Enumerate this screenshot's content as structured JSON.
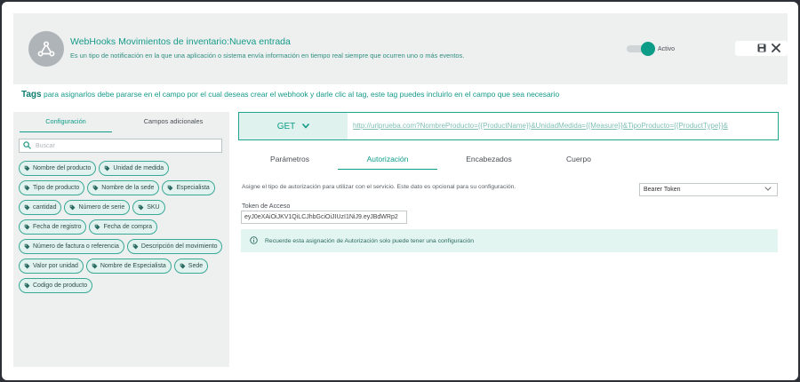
{
  "header": {
    "title": "WebHooks Movimientos de inventario:Nueva entrada",
    "description": "Es un tipo de notificación en la que una aplicación o sistema envía información en tiempo real siempre que ocurren uno o más eventos.",
    "toggle_label": "Activo",
    "toggle_on": true,
    "logo_icon": "webhook-icon",
    "save_icon": "save-icon",
    "close_icon": "close-icon"
  },
  "tags_help": {
    "strong": "Tags",
    "text": " para asignarlos debe pararse en el campo por el cual deseas crear el webhook y darle clic al tag, este tag puedes incluirlo en el campo que sea necesario"
  },
  "left_panel": {
    "tabs": [
      "Configuración",
      "Campos adicionales"
    ],
    "active_tab": 0,
    "search_placeholder": "Buscar",
    "tags": [
      "Nombre del producto",
      "Unidad de medida",
      "Tipo de producto",
      "Nombre de la sede",
      "Especialista",
      "cantidad",
      "Número de serie",
      "SKU",
      "Fecha de registro",
      "Fecha de compra",
      "Número de factura o referencia",
      "Descripción del movimiento",
      "Valor por unidad",
      "Nombre de Especialista",
      "Sede",
      "Codigo de producto"
    ]
  },
  "request": {
    "method": "GET",
    "url": "http://urlprueba.com?NombreProducto={{ProductName}}&UnidadMedida={{Measure}}&TipoProducto={{ProductType}}&"
  },
  "tabs": [
    "Parámetros",
    "Autorización",
    "Encabezados",
    "Cuerpo"
  ],
  "active_tab": 1,
  "auth": {
    "note": "Asigne el tipo de autorización para utilizar con el servicio. Este dato es opcional para su configuración.",
    "type_selected": "Bearer Token",
    "token_label": "Token de Acceso",
    "token_value": "eyJ0eXAiOiJKV1QiLCJhbGciOiJIUzI1NiJ9.eyJBdWRp2",
    "alert": "Recuerde esta asignación de Autorización solo puede tener una configuración"
  },
  "colors": {
    "accent": "#0d9c87",
    "panel_bg": "#eef0f0",
    "chip_bg": "#e2f3ef",
    "backdrop": "#2c3036"
  }
}
